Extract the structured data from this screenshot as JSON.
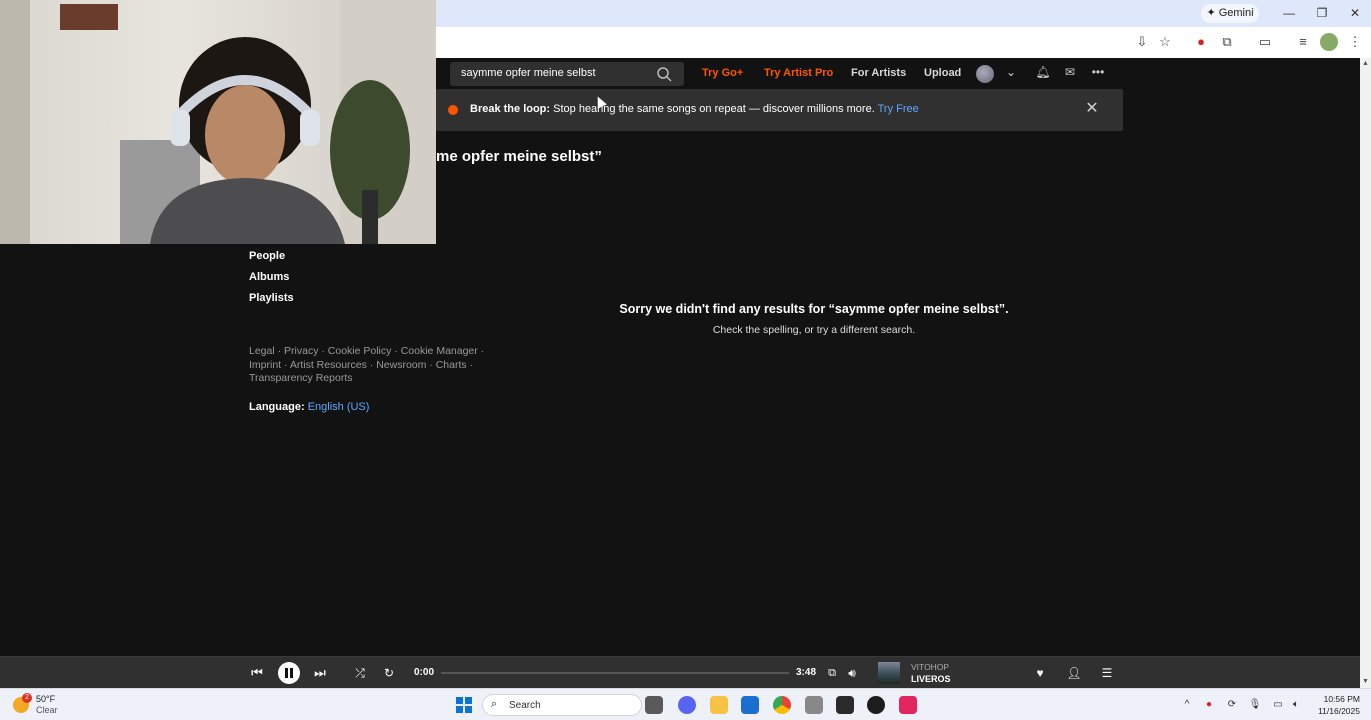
{
  "browser": {
    "gemini_label": "Gemini",
    "window_controls": [
      "minimize-icon",
      "restore-icon",
      "close-icon"
    ]
  },
  "header": {
    "search": {
      "value": "saymme opfer meine selbst",
      "placeholder": "Search"
    },
    "nav": {
      "try_go": "Try Go+",
      "try_artist_pro": "Try Artist Pro",
      "for_artists": "For Artists",
      "upload": "Upload"
    },
    "accent_color": "#ff5500"
  },
  "banner": {
    "bold": "Break the loop:",
    "text": "Stop hearing the same songs on repeat — discover millions more.",
    "link": "Try Free"
  },
  "results_title": "me opfer meine selbst”",
  "sidebar": {
    "items": [
      {
        "label": "People"
      },
      {
        "label": "Albums"
      },
      {
        "label": "Playlists"
      }
    ],
    "footer_links": "Legal · Privacy · Cookie Policy · Cookie Manager · Imprint · Artist Resources · Newsroom · Charts · Transparency Reports",
    "language_label": "Language:",
    "language_value": "English (US)"
  },
  "empty_state": {
    "title": "Sorry we didn't find any results for “saymme opfer meine selbst”.",
    "subtitle": "Check the spelling, or try a different search."
  },
  "player": {
    "current_time": "0:00",
    "duration": "3:48",
    "progress": 0,
    "track_artist": "VITOHOP",
    "track_title": "LIVEROS"
  },
  "taskbar": {
    "weather_temp": "50°F",
    "weather_condition": "Clear",
    "weather_badge": "2",
    "search_label": "Search",
    "clock_time": "10:56 PM",
    "clock_date": "11/16/2025"
  }
}
